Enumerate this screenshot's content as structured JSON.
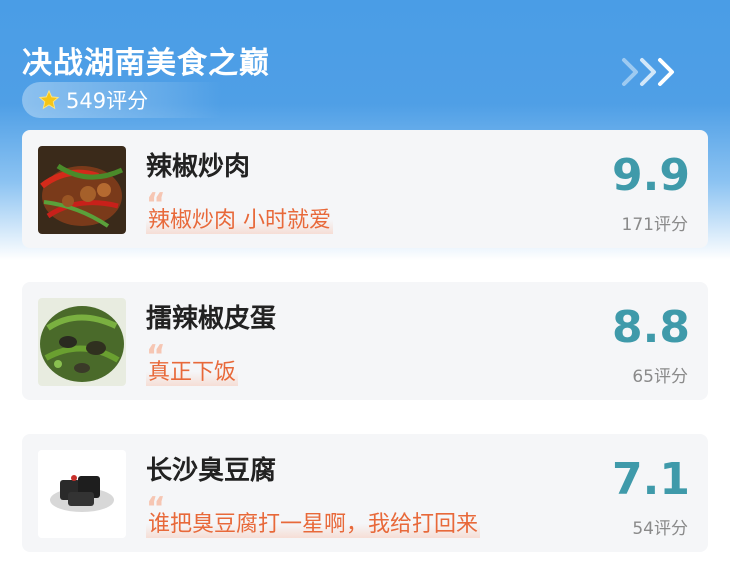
{
  "header": {
    "title": "决战湖南美食之巅",
    "rating": "549评分",
    "star_icon": "star-icon",
    "arrows_icon": "triple-chevron-right-icon"
  },
  "items": [
    {
      "name": "辣椒炒肉",
      "comment": "辣椒炒肉 小时就爱",
      "score": "9.9",
      "count": "171评分"
    },
    {
      "name": "擂辣椒皮蛋",
      "comment": "真正下饭",
      "score": "8.8",
      "count": "65评分"
    },
    {
      "name": "长沙臭豆腐",
      "comment": "谁把臭豆腐打一星啊，我给打回来",
      "score": "7.1",
      "count": "54评分"
    }
  ],
  "colors": {
    "header_bg": "#4a9de6",
    "score": "#3f9aaa",
    "comment": "#e8693a",
    "card_bg": "#f5f6f8"
  }
}
